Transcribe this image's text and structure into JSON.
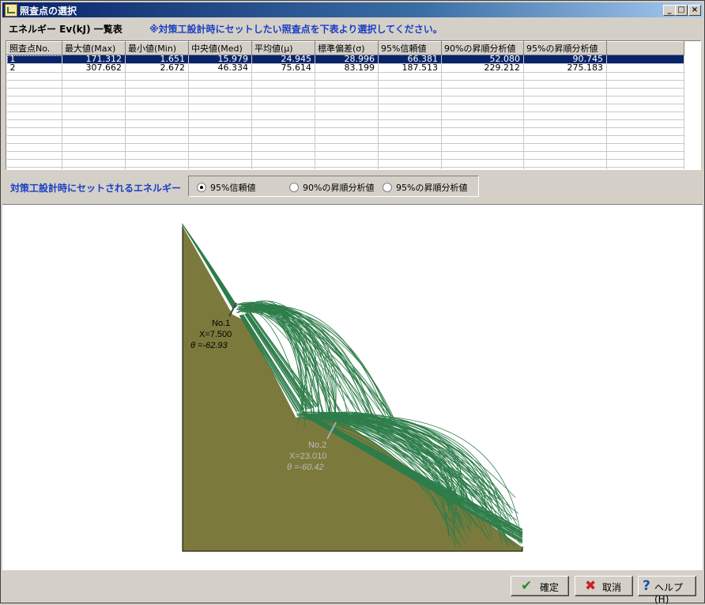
{
  "window": {
    "title": "照査点の選択"
  },
  "title_buttons": {
    "minimize": "_",
    "maximize": "□",
    "close": "×"
  },
  "header": {
    "title": "エネルギー Ev(kJ) 一覧表",
    "note": "※対策工設計時にセットしたい照査点を下表より選択してください。"
  },
  "table": {
    "columns": [
      "照査点No.",
      "最大値(Max)",
      "最小値(Min)",
      "中央値(Med)",
      "平均値(μ)",
      "標準偏差(σ)",
      "95%信頼値",
      "90%の昇順分析値",
      "95%の昇順分析値"
    ],
    "rows": [
      [
        "1",
        "171.312",
        "1.651",
        "15.979",
        "24.945",
        "28.996",
        "66.381",
        "52.080",
        "90.745"
      ],
      [
        "2",
        "307.662",
        "2.672",
        "46.334",
        "75.614",
        "83.199",
        "187.513",
        "229.212",
        "275.183"
      ]
    ],
    "selected_row": 0
  },
  "options": {
    "label": "対策工設計時にセットされるエネルギー",
    "items": [
      "95%信頼値",
      "90%の昇順分析値",
      "95%の昇順分析値"
    ],
    "selected": 0
  },
  "diagram": {
    "points": [
      {
        "label": "No.1",
        "x": "X=7.500",
        "theta": "θ =-62.93"
      },
      {
        "label": "No.2",
        "x": "X=23.010",
        "theta": "θ =-60.42"
      }
    ],
    "colors": {
      "slope": "#7b7a3c",
      "trajectory": "#2e7d4a"
    }
  },
  "buttons": {
    "ok": "確定",
    "cancel": "取消",
    "help": "ヘルプ(H)"
  }
}
